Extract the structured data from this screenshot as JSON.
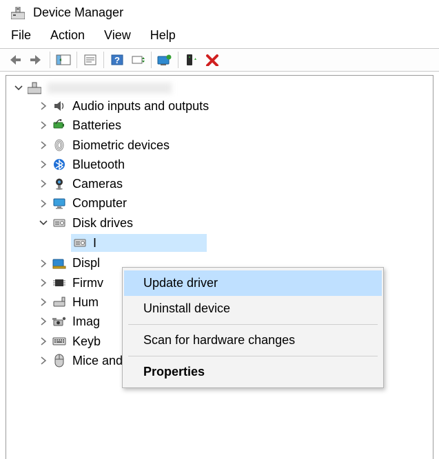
{
  "window": {
    "title": "Device Manager"
  },
  "menubar": [
    "File",
    "Action",
    "View",
    "Help"
  ],
  "root_label": "",
  "tree": [
    {
      "label": "Audio inputs and outputs",
      "icon": "audio"
    },
    {
      "label": "Batteries",
      "icon": "battery"
    },
    {
      "label": "Biometric devices",
      "icon": "biometric"
    },
    {
      "label": "Bluetooth",
      "icon": "bluetooth"
    },
    {
      "label": "Cameras",
      "icon": "camera"
    },
    {
      "label": "Computer",
      "icon": "computer"
    },
    {
      "label": "Disk drives",
      "icon": "disk",
      "expanded": true
    },
    {
      "label": "Displ",
      "icon": "display"
    },
    {
      "label": "Firmv",
      "icon": "firmware"
    },
    {
      "label": "Hum",
      "icon": "hid"
    },
    {
      "label": "Imag",
      "icon": "imaging"
    },
    {
      "label": "Keyb",
      "icon": "keyboard"
    },
    {
      "label": "Mice and other pointing devices",
      "icon": "mouse"
    }
  ],
  "disk_child": {
    "label_partial": "I",
    "icon": "disk"
  },
  "context_menu": {
    "update": "Update driver",
    "uninstall": "Uninstall device",
    "scan": "Scan for hardware changes",
    "properties": "Properties"
  }
}
